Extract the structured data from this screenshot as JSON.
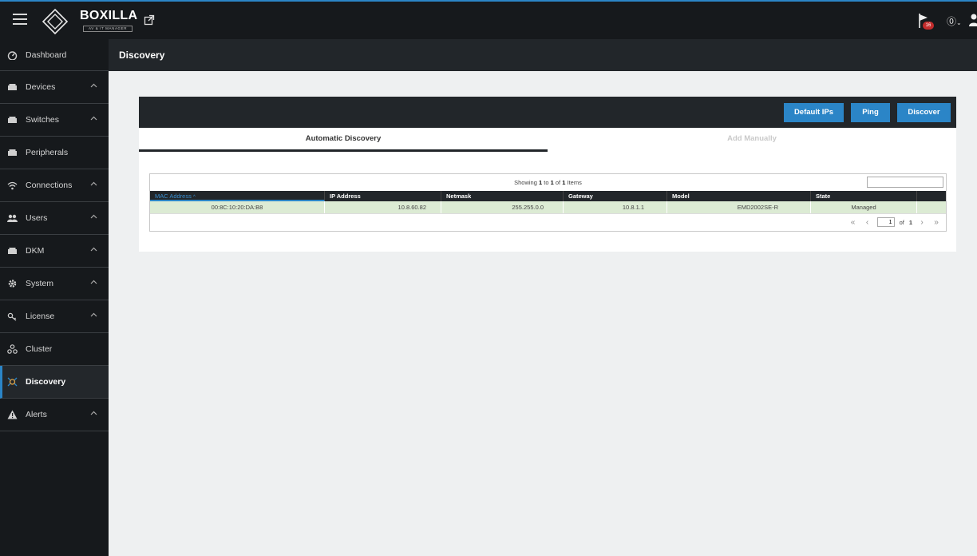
{
  "app": {
    "brand": "BOXILLA",
    "brand_sub": "AV & IT MANAGER",
    "notification_count": "16"
  },
  "sidebar": {
    "items": [
      {
        "label": "Dashboard",
        "icon": "dashboard-icon",
        "expandable": false,
        "active": false
      },
      {
        "label": "Devices",
        "icon": "device-icon",
        "expandable": true,
        "active": false
      },
      {
        "label": "Switches",
        "icon": "switch-icon",
        "expandable": true,
        "active": false
      },
      {
        "label": "Peripherals",
        "icon": "peripheral-icon",
        "expandable": false,
        "active": false
      },
      {
        "label": "Connections",
        "icon": "wifi-icon",
        "expandable": true,
        "active": false
      },
      {
        "label": "Users",
        "icon": "users-icon",
        "expandable": true,
        "active": false
      },
      {
        "label": "DKM",
        "icon": "dkm-icon",
        "expandable": true,
        "active": false
      },
      {
        "label": "System",
        "icon": "gear-icon",
        "expandable": true,
        "active": false
      },
      {
        "label": "License",
        "icon": "key-icon",
        "expandable": true,
        "active": false
      },
      {
        "label": "Cluster",
        "icon": "cluster-icon",
        "expandable": false,
        "active": false
      },
      {
        "label": "Discovery",
        "icon": "discovery-icon",
        "expandable": false,
        "active": true
      },
      {
        "label": "Alerts",
        "icon": "alert-icon",
        "expandable": true,
        "active": false
      }
    ]
  },
  "page": {
    "title": "Discovery"
  },
  "toolbar": {
    "default_ips_label": "Default IPs",
    "ping_label": "Ping",
    "discover_label": "Discover"
  },
  "tabs": {
    "automatic": "Automatic Discovery",
    "manual": "Add Manually"
  },
  "grid": {
    "status_prefix": "Showing",
    "status_from": "1",
    "status_to_word": "to",
    "status_to": "1",
    "status_of_word": "of",
    "status_total": "1",
    "status_suffix": "Items",
    "search_value": "",
    "columns": [
      "MAC Address",
      "IP Address",
      "Netmask",
      "Gateway",
      "Model",
      "State"
    ],
    "sort_indicator": "^",
    "rows": [
      {
        "mac": "00:8C:10:20:DA:B8",
        "ip": "10.8.60.82",
        "netmask": "255.255.0.0",
        "gateway": "10.8.1.1",
        "model": "EMD2002SE-R",
        "state": "Managed"
      }
    ],
    "pager": {
      "page": "1",
      "of_label": "of",
      "total_pages": "1"
    }
  },
  "colors": {
    "accent": "#2b85c7",
    "dark": "#16191c",
    "row_selected": "#dcebd4",
    "badge": "#c32c2c"
  }
}
